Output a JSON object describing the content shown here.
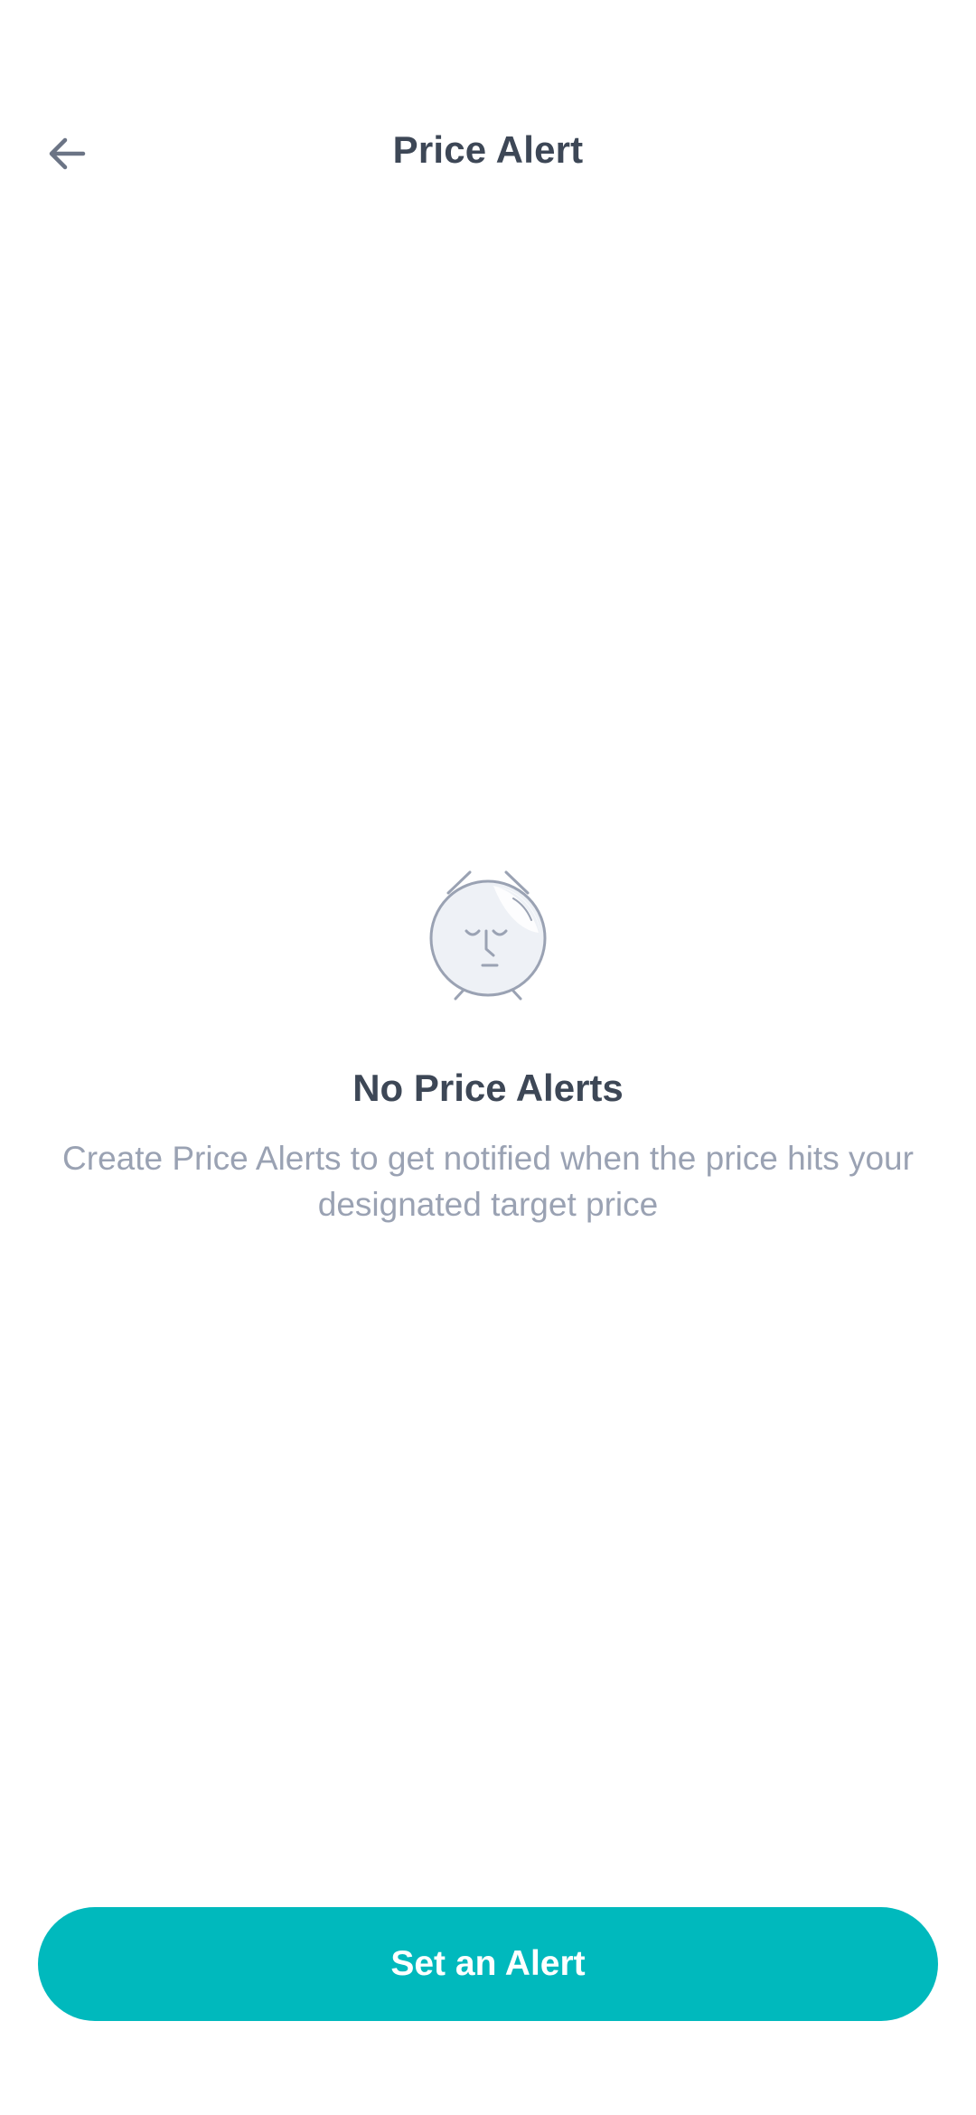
{
  "header": {
    "back_icon": "arrow-left-icon",
    "title": "Price Alert"
  },
  "empty_state": {
    "icon": "sleeping-alarm-clock-icon",
    "title": "No Price Alerts",
    "subtitle": "Create Price Alerts to get notified when the price hits your designated target price"
  },
  "cta": {
    "label": "Set an Alert"
  },
  "colors": {
    "accent": "#00b9bd",
    "title_text": "#3d4756",
    "muted_text": "#9aa2b3",
    "icon_stroke": "#9aa2b3",
    "icon_fill": "#eef1f6"
  }
}
